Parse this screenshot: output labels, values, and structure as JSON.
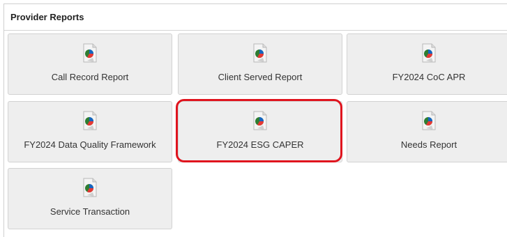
{
  "panel": {
    "title": "Provider Reports"
  },
  "tiles": [
    {
      "label": "Call Record Report"
    },
    {
      "label": "Client Served Report"
    },
    {
      "label": "FY2024 CoC APR"
    },
    {
      "label": "FY2024 Data Quality Framework"
    },
    {
      "label": "FY2024 ESG CAPER"
    },
    {
      "label": "Needs Report"
    },
    {
      "label": "Service Transaction"
    }
  ],
  "icon": {
    "name": "report-pie-chart-icon"
  },
  "colors": {
    "highlight": "#e0141e",
    "tile_bg": "#eeeeee"
  }
}
